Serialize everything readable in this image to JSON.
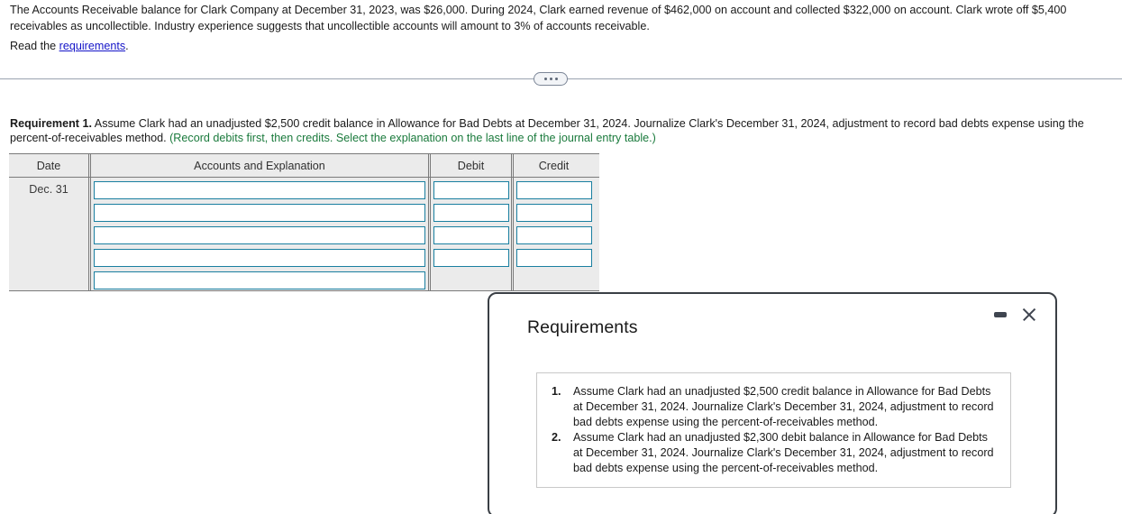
{
  "problem": {
    "statement": "The Accounts Receivable balance for Clark Company at December 31, 2023, was $26,000. During 2024, Clark earned revenue of $462,000 on account and collected $322,000 on account. Clark wrote off $5,400 receivables as uncollectible. Industry experience suggests that uncollectible accounts will amount to 3% of accounts receivable.",
    "read_prefix": "Read the ",
    "read_link": "requirements",
    "read_suffix": "."
  },
  "divider": {
    "icon": "ellipsis-icon"
  },
  "requirement1": {
    "label": "Requirement 1.",
    "text": " Assume Clark had an unadjusted $2,500 credit balance in Allowance for Bad Debts at December 31, 2024. Journalize Clark's December 31, 2024, adjustment to record bad debts expense using the percent-of-receivables method. ",
    "hint": "(Record debits first, then credits. Select the explanation on the last line of the journal entry table.)",
    "hint_color": "#1a7a3c"
  },
  "journal": {
    "headers": {
      "date": "Date",
      "accounts": "Accounts and Explanation",
      "debit": "Debit",
      "credit": "Credit"
    },
    "date_value": "Dec. 31",
    "accounts_rows": [
      "",
      "",
      "",
      "",
      ""
    ],
    "debit_rows": [
      "",
      "",
      "",
      ""
    ],
    "credit_rows": [
      "",
      "",
      "",
      ""
    ],
    "input_border_color": "#1a7fa0"
  },
  "dialog": {
    "title": "Requirements",
    "minimize_icon": "minimize-icon",
    "close_icon": "close-icon",
    "items": [
      {
        "number": "1.",
        "text": "Assume Clark had an unadjusted $2,500 credit balance in Allowance for Bad Debts at December 31, 2024. Journalize Clark's December 31, 2024, adjustment to record bad debts expense using the percent-of-receivables method."
      },
      {
        "number": "2.",
        "text": "Assume Clark had an unadjusted $2,300 debit balance in Allowance for Bad Debts at December 31, 2024. Journalize Clark's December 31, 2024, adjustment to record bad debts expense using the percent-of-receivables method."
      }
    ]
  }
}
